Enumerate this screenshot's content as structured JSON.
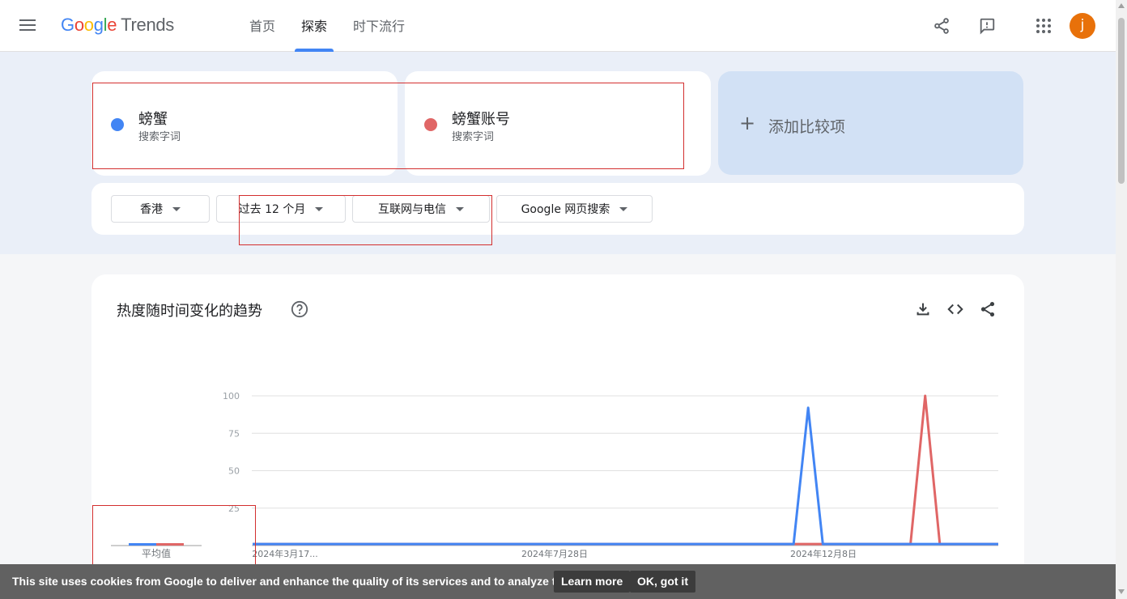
{
  "header": {
    "logo": {
      "letters": [
        "G",
        "o",
        "o",
        "g",
        "l",
        "e"
      ],
      "product": "Trends"
    },
    "tabs": [
      {
        "label": "首页",
        "active": false
      },
      {
        "label": "探索",
        "active": true
      },
      {
        "label": "时下流行",
        "active": false
      }
    ],
    "avatar_initial": "j",
    "icons": [
      "menu-icon",
      "share-icon",
      "feedback-icon",
      "apps-icon"
    ]
  },
  "terms": [
    {
      "name": "螃蟹",
      "type": "搜索字词",
      "color": "#4285f4"
    },
    {
      "name": "螃蟹账号",
      "type": "搜索字词",
      "color": "#e06666"
    }
  ],
  "add_compare": {
    "label": "添加比较项"
  },
  "filters": [
    {
      "label": "香港"
    },
    {
      "label": "过去 12 个月"
    },
    {
      "label": "互联网与电信"
    },
    {
      "label": "Google 网页搜索"
    }
  ],
  "chart_section": {
    "title": "热度随时间变化的趋势",
    "icons": [
      "help-icon",
      "download-icon",
      "embed-icon",
      "share-icon"
    ]
  },
  "chart_data": {
    "type": "line",
    "y_ticks": [
      100,
      75,
      50,
      25
    ],
    "ylim": [
      0,
      100
    ],
    "x_tick_labels": [
      "2024年3月17...",
      "2024年7月28日",
      "2024年12月8日"
    ],
    "average_label": "平均值",
    "average": [
      {
        "name": "螃蟹",
        "value": 1
      },
      {
        "name": "螃蟹账号",
        "value": 1
      }
    ],
    "series": [
      {
        "name": "螃蟹",
        "color": "#4285f4",
        "x": [
          "2024-03-17",
          "2024-12-01",
          "2024-12-08",
          "2024-12-15",
          "2025-03-09"
        ],
        "values": [
          1,
          1,
          92,
          1,
          1
        ]
      },
      {
        "name": "螃蟹账号",
        "color": "#e06666",
        "x": [
          "2024-03-17",
          "2025-01-26",
          "2025-02-02",
          "2025-02-09",
          "2025-03-09"
        ],
        "values": [
          1,
          1,
          100,
          1,
          1
        ]
      }
    ],
    "grid": true
  },
  "cookie_bar": {
    "text": "This site uses cookies from Google to deliver and enhance the quality of its services and to analyze traffic.",
    "learn_more": "Learn more",
    "ok": "OK, got it"
  }
}
